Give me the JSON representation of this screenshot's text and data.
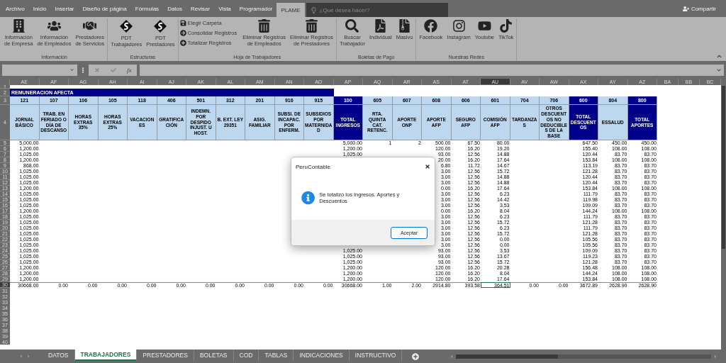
{
  "menu_tabs": [
    {
      "label": "Archivo",
      "selected": false
    },
    {
      "label": "Inicio",
      "selected": false
    },
    {
      "label": "Insertar",
      "selected": false
    },
    {
      "label": "Diseño de página",
      "selected": false
    },
    {
      "label": "Fórmulas",
      "selected": false
    },
    {
      "label": "Datos",
      "selected": false
    },
    {
      "label": "Revisar",
      "selected": false
    },
    {
      "label": "Vista",
      "selected": false
    },
    {
      "label": "Programador",
      "selected": false
    },
    {
      "label": "PLAME",
      "selected": true
    }
  ],
  "search": {
    "placeholder": "¿Qué desea hacer?"
  },
  "share_button": "Compartir",
  "ribbon": {
    "groups": [
      {
        "label": "Información",
        "items": [
          {
            "kind": "large",
            "label": "Información\nde Empresa"
          },
          {
            "kind": "large",
            "label": "Información\nde Empleados"
          },
          {
            "kind": "large",
            "label": "Prestadores\nde Servicios"
          }
        ]
      },
      {
        "label": "Estructuras",
        "items": [
          {
            "kind": "large",
            "label": "PDT\nTrabajadores"
          },
          {
            "kind": "large",
            "label": "PDT\nPrestadores"
          }
        ]
      },
      {
        "label": "Hoja de Trabajadores",
        "items": [
          {
            "kind": "small",
            "label": "Elegir Carpeta"
          },
          {
            "kind": "small",
            "label": "Consolidar Registros"
          },
          {
            "kind": "small",
            "label": "Totalizar Registros"
          },
          {
            "kind": "large",
            "label": "Eliminar Registros\nde Empleados"
          },
          {
            "kind": "large",
            "label": "Eliminar Registros\nde Prestadores"
          }
        ]
      },
      {
        "label": "Boletas de Pago",
        "items": [
          {
            "kind": "large",
            "label": "Buscar\nTrabajador"
          },
          {
            "kind": "large",
            "label": "Individual"
          },
          {
            "kind": "large",
            "label": "Masivo"
          }
        ]
      },
      {
        "label": "Nuestras Redes",
        "items": [
          {
            "kind": "large",
            "label": "Facebook"
          },
          {
            "kind": "large",
            "label": "Instagram"
          },
          {
            "kind": "large",
            "label": "Youtube"
          },
          {
            "kind": "large",
            "label": "TikTok"
          }
        ]
      }
    ]
  },
  "formula_bar": {
    "function_label": "fx"
  },
  "sheet": {
    "header_row_numbers": [
      "1",
      "2",
      "3",
      "4"
    ],
    "banner": "REMUNERACION AFECTA",
    "columns": [
      {
        "letter": "AE",
        "code": "121",
        "label": "JORNAL BÁSICO",
        "kind": "item",
        "selected": false
      },
      {
        "letter": "AF",
        "code": "107",
        "label": "TRAB. EN FERIADO O DÍA DE DESCANSO",
        "kind": "item",
        "selected": false
      },
      {
        "letter": "AG",
        "code": "106",
        "label": "HORAS EXTRAS 35%",
        "kind": "item",
        "selected": false
      },
      {
        "letter": "AH",
        "code": "105",
        "label": "HORAS EXTRAS 25%",
        "kind": "item",
        "selected": false
      },
      {
        "letter": "AI",
        "code": "118",
        "label": "VACACIONES",
        "kind": "item",
        "selected": false
      },
      {
        "letter": "AJ",
        "code": "406",
        "label": "GRATIFICACIÓN",
        "kind": "item",
        "selected": false
      },
      {
        "letter": "AK",
        "code": "501",
        "label": "INDEMN. POR DESPIDO INJUST. U HOST.",
        "kind": "item",
        "selected": false
      },
      {
        "letter": "AL",
        "code": "312",
        "label": "B. EXT. LEY 29351",
        "kind": "item",
        "selected": false
      },
      {
        "letter": "AM",
        "code": "201",
        "label": "ASIG. FAMILIAR",
        "kind": "item",
        "selected": false
      },
      {
        "letter": "AN",
        "code": "916",
        "label": "SUBSI. DE INCAPAC. POR ENFERM.",
        "kind": "item",
        "selected": false
      },
      {
        "letter": "AO",
        "code": "915",
        "label": "SUBSIDIOS POR MATERNIDAD",
        "kind": "item",
        "selected": false
      },
      {
        "letter": "AP",
        "code": "100",
        "label": "TOTAL INGRESOS",
        "kind": "total",
        "selected": false
      },
      {
        "letter": "AQ",
        "code": "605",
        "label": "RTA. QUINTA CAT. RETENC.",
        "kind": "item",
        "selected": false
      },
      {
        "letter": "AR",
        "code": "607",
        "label": "APORTE ONP",
        "kind": "item",
        "selected": false
      },
      {
        "letter": "AS",
        "code": "608",
        "label": "APORTE AFP",
        "kind": "item",
        "selected": false
      },
      {
        "letter": "AT",
        "code": "606",
        "label": "SEGURO AFP",
        "kind": "item",
        "selected": false
      },
      {
        "letter": "AU",
        "code": "601",
        "label": "COMISIÓN AFP",
        "kind": "item",
        "selected": true
      },
      {
        "letter": "AV",
        "code": "704",
        "label": "TARDANZAS",
        "kind": "item",
        "selected": false
      },
      {
        "letter": "AW",
        "code": "706",
        "label": "OTROS DESCUENTOS NO DEDUCIBLES DE LA BASE",
        "kind": "item",
        "selected": false
      },
      {
        "letter": "AX",
        "code": "600",
        "label": "TOTAL DESCUENTOS",
        "kind": "total",
        "selected": false
      },
      {
        "letter": "AY",
        "code": "804",
        "label": "ESSALUD",
        "kind": "item",
        "selected": false
      },
      {
        "letter": "AZ",
        "code": "800",
        "label": "TOTAL APORTES",
        "kind": "total",
        "selected": false
      }
    ],
    "extra_columns": [
      {
        "letter": "BA",
        "selected": false
      },
      {
        "letter": "BB",
        "selected": false
      },
      {
        "letter": "BC",
        "selected": false
      }
    ],
    "rows": [
      {
        "n": "5",
        "kind": "data",
        "selected": false,
        "cells": {
          "AE": "5,000.00",
          "AP": "5,000.00",
          "AQ": "1",
          "AR": "2",
          "AS": "500.00",
          "AT": "67.50",
          "AU": "80.00",
          "AX": "647.50",
          "AY": "450.00",
          "AZ": "450.00"
        }
      },
      {
        "n": "6",
        "kind": "data",
        "selected": false,
        "cells": {
          "AE": "1,200.00",
          "AP": "1,200.00",
          "AS": "120.00",
          "AT": "16.20",
          "AU": "19.20",
          "AX": "155.40",
          "AY": "108.00",
          "AZ": "108.00"
        }
      },
      {
        "n": "7",
        "kind": "data",
        "selected": false,
        "cells": {
          "AE": "1,025.00",
          "AP": "1,025.00",
          "AS": "93.00",
          "AT": "12.56",
          "AU": "14.88",
          "AX": "120.44",
          "AY": "83.70",
          "AZ": "83.70"
        }
      },
      {
        "n": "8",
        "kind": "data",
        "selected": false,
        "cells": {
          "AE": "1,200.00",
          "AS": "20.00",
          "AT": "16.20",
          "AU": "17.64",
          "AX": "153.84",
          "AY": "108.00",
          "AZ": "108.00"
        }
      },
      {
        "n": "9",
        "kind": "data",
        "selected": false,
        "cells": {
          "AE": "868.00",
          "AS": "6.80",
          "AT": "11.72",
          "AU": "14.67",
          "AX": "113.19",
          "AY": "83.70",
          "AZ": "83.70"
        }
      },
      {
        "n": "10",
        "kind": "data",
        "selected": false,
        "cells": {
          "AE": "1,025.00",
          "AS": "3.00",
          "AT": "12.56",
          "AU": "15.72",
          "AX": "121.28",
          "AY": "83.70",
          "AZ": "83.70"
        }
      },
      {
        "n": "11",
        "kind": "data",
        "selected": false,
        "cells": {
          "AE": "1,025.00",
          "AS": "3.00",
          "AT": "12.56",
          "AU": "14.88",
          "AX": "120.44",
          "AY": "83.70",
          "AZ": "83.70"
        }
      },
      {
        "n": "12",
        "kind": "data",
        "selected": false,
        "cells": {
          "AE": "1,025.00",
          "AS": "3.00",
          "AT": "12.56",
          "AU": "14.88",
          "AX": "120.44",
          "AY": "83.70",
          "AZ": "83.70"
        }
      },
      {
        "n": "13",
        "kind": "data",
        "selected": false,
        "cells": {
          "AE": "1,200.00",
          "AS": "0.00",
          "AT": "16.20",
          "AU": "17.64",
          "AX": "153.84",
          "AY": "108.00",
          "AZ": "108.00"
        }
      },
      {
        "n": "14",
        "kind": "data",
        "selected": false,
        "cells": {
          "AE": "1,025.00",
          "AS": "3.00",
          "AT": "12.56",
          "AU": "6.23",
          "AX": "111.79",
          "AY": "83.70",
          "AZ": "83.70"
        }
      },
      {
        "n": "15",
        "kind": "data",
        "selected": false,
        "cells": {
          "AE": "1,025.00",
          "AS": "3.00",
          "AT": "12.56",
          "AU": "14.42",
          "AX": "119.98",
          "AY": "83.70",
          "AZ": "83.70"
        }
      },
      {
        "n": "16",
        "kind": "data",
        "selected": false,
        "cells": {
          "AE": "1,025.00",
          "AS": "3.00",
          "AT": "12.56",
          "AU": "3.53",
          "AX": "109.09",
          "AY": "83.70",
          "AZ": "83.70"
        }
      },
      {
        "n": "17",
        "kind": "data",
        "selected": false,
        "cells": {
          "AE": "1,200.00",
          "AS": "0.00",
          "AT": "16.20",
          "AU": "8.04",
          "AX": "144.24",
          "AY": "108.00",
          "AZ": "108.00"
        }
      },
      {
        "n": "18",
        "kind": "data",
        "selected": false,
        "cells": {
          "AE": "1,025.00",
          "AS": "3.00",
          "AT": "12.56",
          "AU": "6.23",
          "AX": "111.79",
          "AY": "83.70",
          "AZ": "83.70"
        }
      },
      {
        "n": "19",
        "kind": "data",
        "selected": false,
        "cells": {
          "AE": "1,025.00",
          "AS": "3.00",
          "AT": "12.56",
          "AU": "15.72",
          "AX": "121.28",
          "AY": "83.70",
          "AZ": "83.70"
        }
      },
      {
        "n": "20",
        "kind": "data",
        "selected": false,
        "cells": {
          "AE": "1,025.00",
          "AS": "3.00",
          "AT": "12.56",
          "AU": "6.23",
          "AX": "111.79",
          "AY": "83.70",
          "AZ": "83.70"
        }
      },
      {
        "n": "21",
        "kind": "data",
        "selected": false,
        "cells": {
          "AE": "1,025.00",
          "AS": "3.00",
          "AT": "12.56",
          "AU": "15.72",
          "AX": "121.28",
          "AY": "83.70",
          "AZ": "83.70"
        }
      },
      {
        "n": "22",
        "kind": "data",
        "selected": false,
        "cells": {
          "AE": "1,025.00",
          "AS": "3.00",
          "AT": "12.56",
          "AU": "0.00",
          "AX": "105.56",
          "AY": "83.70",
          "AZ": "83.70"
        }
      },
      {
        "n": "23",
        "kind": "data",
        "selected": false,
        "cells": {
          "AE": "1,025.00",
          "AS": "3.00",
          "AT": "12.56",
          "AU": "0.00",
          "AX": "105.56",
          "AY": "83.70",
          "AZ": "83.70"
        }
      },
      {
        "n": "24",
        "kind": "data",
        "selected": false,
        "cells": {
          "AE": "1,025.00",
          "AP": "1,025.00",
          "AS": "93.00",
          "AT": "12.56",
          "AU": "3.53",
          "AX": "109.09",
          "AY": "83.70",
          "AZ": "83.70"
        }
      },
      {
        "n": "25",
        "kind": "data",
        "selected": false,
        "cells": {
          "AE": "1,025.00",
          "AP": "1,025.00",
          "AS": "93.00",
          "AT": "12.56",
          "AU": "13.67",
          "AX": "119.23",
          "AY": "83.70",
          "AZ": "83.70"
        }
      },
      {
        "n": "26",
        "kind": "data",
        "selected": false,
        "cells": {
          "AE": "1,025.00",
          "AP": "1,025.00",
          "AS": "93.00",
          "AT": "12.56",
          "AU": "15.72",
          "AX": "121.28",
          "AY": "83.70",
          "AZ": "83.70"
        }
      },
      {
        "n": "27",
        "kind": "data",
        "selected": false,
        "cells": {
          "AE": "1,200.00",
          "AP": "1,200.00",
          "AS": "120.00",
          "AT": "16.20",
          "AU": "20.28",
          "AX": "156.48",
          "AY": "108.00",
          "AZ": "108.00"
        }
      },
      {
        "n": "28",
        "kind": "data",
        "selected": false,
        "cells": {
          "AE": "1,200.00",
          "AP": "1,200.00",
          "AS": "120.00",
          "AT": "16.20",
          "AU": "8.04",
          "AX": "144.24",
          "AY": "108.00",
          "AZ": "108.00"
        }
      },
      {
        "n": "29",
        "kind": "data",
        "selected": false,
        "cells": {
          "AE": "1,200.00",
          "AP": "1,200.00",
          "AS": "120.00",
          "AT": "16.20",
          "AU": "17.64",
          "AX": "153.84",
          "AY": "108.00",
          "AZ": "108.00"
        }
      },
      {
        "n": "30",
        "kind": "total",
        "selected": true,
        "cells": {
          "AE": "30668.00",
          "AF": "0.00",
          "AG": "0.00",
          "AH": "0.00",
          "AI": "0.00",
          "AJ": "0.00",
          "AK": "0.00",
          "AL": "0.00",
          "AM": "0.00",
          "AN": "0.00",
          "AO": "0.00",
          "AP": "30668.00",
          "AQ": "1.00",
          "AR": "2.00",
          "AS": "2914.80",
          "AT": "393.58",
          "AU": "364.51",
          "AV": "0.00",
          "AW": "0.00",
          "AX": "3672.89",
          "AY": "2628.90",
          "AZ": "2628.90"
        }
      }
    ],
    "empty_rows": [
      "31",
      "32",
      "33",
      "34",
      "35",
      "36",
      "37",
      "38",
      "39",
      "40"
    ]
  },
  "dialog": {
    "title": "PeruContable",
    "message": "Se totalizó los Ingresos. Aportes y Descuentos",
    "button": "Aceptar"
  },
  "sheet_tabs": [
    {
      "label": "DATOS",
      "selected": false
    },
    {
      "label": "TRABAJADORES",
      "selected": true
    },
    {
      "label": "PRESTADORES",
      "selected": false
    },
    {
      "label": "BOLETAS",
      "selected": false
    },
    {
      "label": "COD",
      "selected": false
    },
    {
      "label": "TABLAS",
      "selected": false
    },
    {
      "label": "INDICACIONES",
      "selected": false
    },
    {
      "label": "INSTRUCTIVO",
      "selected": false
    }
  ]
}
